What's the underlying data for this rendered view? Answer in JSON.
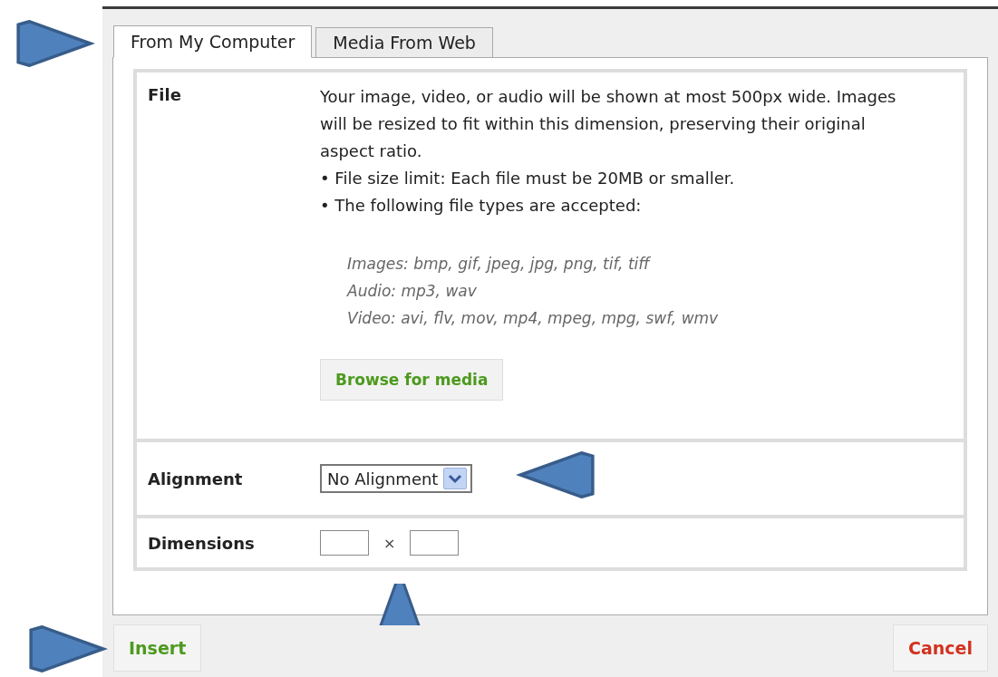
{
  "tabs": [
    {
      "label": "From My Computer",
      "selected": true
    },
    {
      "label": "Media From Web",
      "selected": false
    }
  ],
  "file": {
    "label": "File",
    "description": "Your image, video, or audio will be shown at most 500px wide. Images will be resized to fit within this dimension, preserving their original aspect ratio.",
    "bullets": [
      "File size limit: Each file must be 20MB or smaller.",
      "The following file types are accepted:"
    ],
    "bullet_mark": "•",
    "file_types": [
      "Images: bmp, gif, jpeg, jpg, png, tif, tiff",
      "Audio: mp3, wav",
      "Video: avi, flv, mov, mp4, mpeg, mpg, swf, wmv"
    ],
    "browse_button": "Browse for media"
  },
  "alignment": {
    "label": "Alignment",
    "value": "No Alignment"
  },
  "dimensions": {
    "label": "Dimensions",
    "separator": "×"
  },
  "buttons": [
    {
      "label": "Insert",
      "kind": "primary"
    },
    {
      "label": "Cancel",
      "kind": "danger"
    }
  ]
}
